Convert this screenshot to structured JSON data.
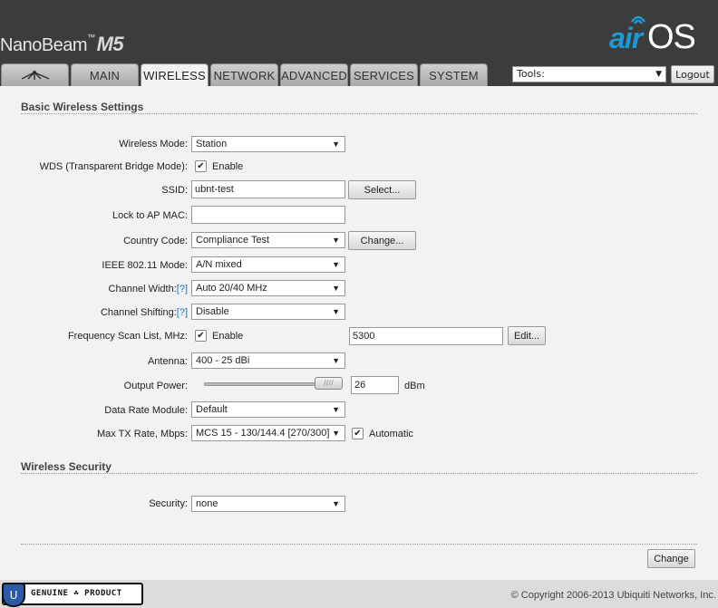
{
  "header": {
    "brand_name": "NanoBeam",
    "brand_tm": "™",
    "brand_model": "M5",
    "logo_air": "air",
    "logo_os": "OS"
  },
  "tabs": [
    {
      "label": ""
    },
    {
      "label": "MAIN"
    },
    {
      "label": "WIRELESS"
    },
    {
      "label": "NETWORK"
    },
    {
      "label": "ADVANCED"
    },
    {
      "label": "SERVICES"
    },
    {
      "label": "SYSTEM"
    }
  ],
  "tools": {
    "label": "Tools:",
    "arrow": "▼"
  },
  "logout_label": "Logout",
  "basic": {
    "title": "Basic Wireless Settings",
    "wireless_mode": {
      "label": "Wireless Mode:",
      "value": "Station"
    },
    "wds": {
      "label": "WDS (Transparent Bridge Mode):",
      "check": "✔",
      "text": "Enable"
    },
    "ssid": {
      "label": "SSID:",
      "value": "ubnt-test",
      "button": "Select..."
    },
    "lock_ap": {
      "label": "Lock to AP MAC:",
      "value": ""
    },
    "country": {
      "label": "Country Code:",
      "value": "Compliance Test",
      "button": "Change..."
    },
    "ieee": {
      "label": "IEEE 802.11 Mode:",
      "value": "A/N mixed"
    },
    "channel_width": {
      "label": "Channel Width:",
      "help": "[?]",
      "value": "Auto 20/40 MHz"
    },
    "channel_shift": {
      "label": "Channel Shifting:",
      "help": "[?]",
      "value": "Disable"
    },
    "freq_scan": {
      "label": "Frequency Scan List, MHz:",
      "check": "✔",
      "text": "Enable",
      "value": "5300",
      "button": "Edit..."
    },
    "antenna": {
      "label": "Antenna:",
      "value": "400 - 25 dBi"
    },
    "output_power": {
      "label": "Output Power:",
      "value": "26",
      "unit": "dBm",
      "handle": "////"
    },
    "data_rate": {
      "label": "Data Rate Module:",
      "value": "Default"
    },
    "max_tx": {
      "label": "Max TX Rate, Mbps:",
      "value": "MCS 15 - 130/144.4 [270/300]",
      "check": "✔",
      "text": "Automatic"
    }
  },
  "security": {
    "title": "Wireless Security",
    "security": {
      "label": "Security:",
      "value": "none"
    }
  },
  "change_label": "Change",
  "footer": {
    "genuine_text": "GENUINE ☘ PRODUCT",
    "shield_icon": "U",
    "copyright": "© Copyright 2006-2013 Ubiquiti Networks, Inc."
  },
  "colors": {
    "header_bg": "#3c3c3c",
    "accent_blue": "#1a9ad6",
    "content_bg": "#f2f2f2"
  }
}
